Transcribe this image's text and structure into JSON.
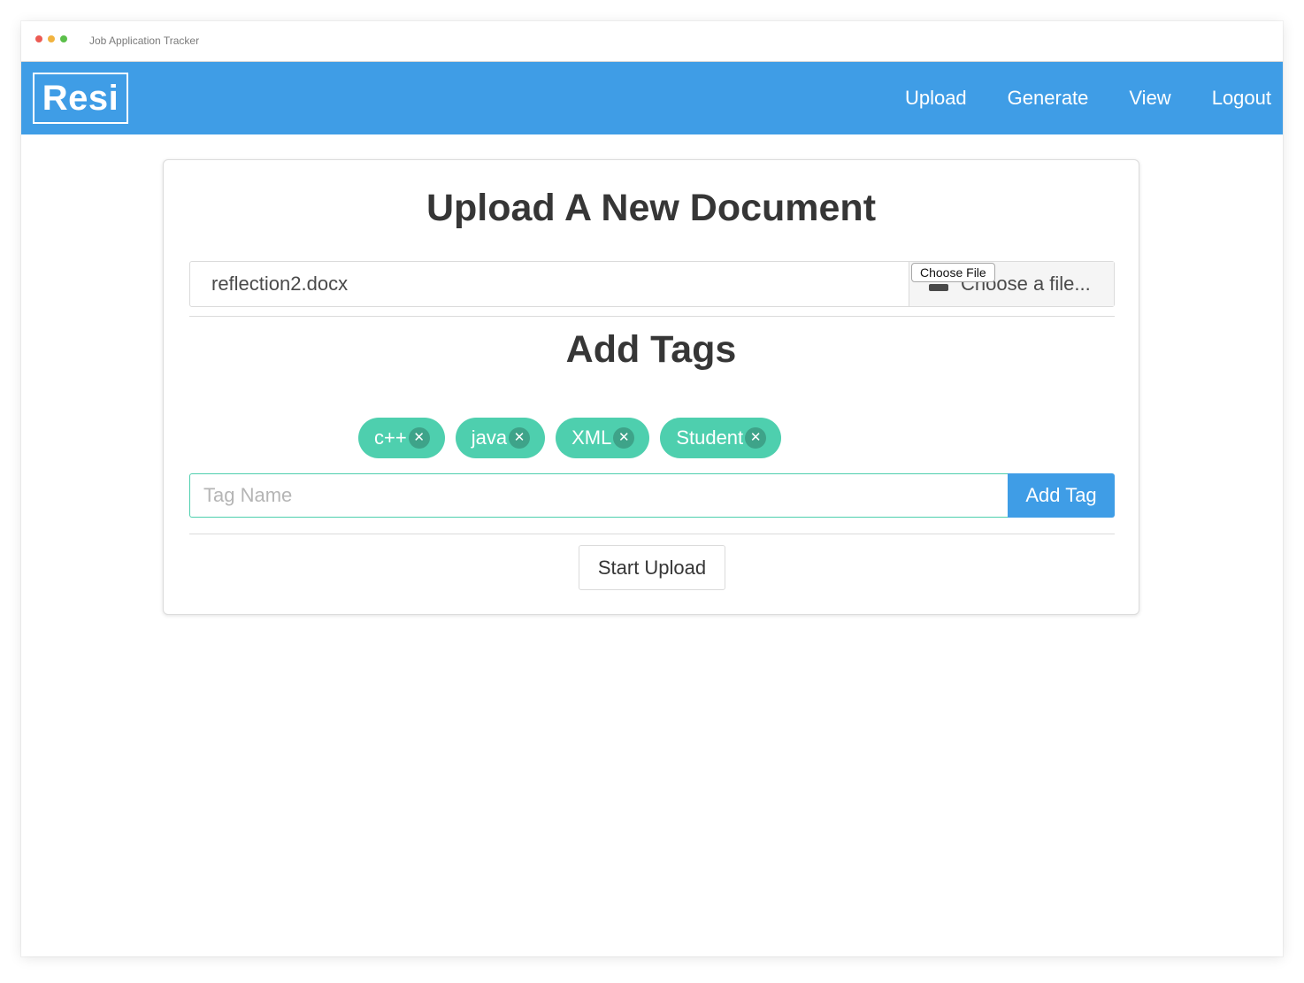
{
  "window": {
    "title": "Job Application Tracker"
  },
  "navbar": {
    "brand": "Resi",
    "links": [
      "Upload",
      "Generate",
      "View",
      "Logout"
    ],
    "color": "#3f9de6"
  },
  "card": {
    "title": "Upload A New Document",
    "file": {
      "name": "reflection2.docx",
      "cta_label": "Choose a file...",
      "native_button": "Choose File"
    },
    "tags_title": "Add Tags",
    "tags": [
      {
        "label": "c++"
      },
      {
        "label": "java"
      },
      {
        "label": "XML"
      },
      {
        "label": "Student"
      }
    ],
    "tag_color": "#4ecfae",
    "tag_delete_glyph": "✕",
    "tag_input": {
      "value": "",
      "placeholder": "Tag Name"
    },
    "add_tag_label": "Add Tag",
    "start_upload_label": "Start Upload"
  }
}
